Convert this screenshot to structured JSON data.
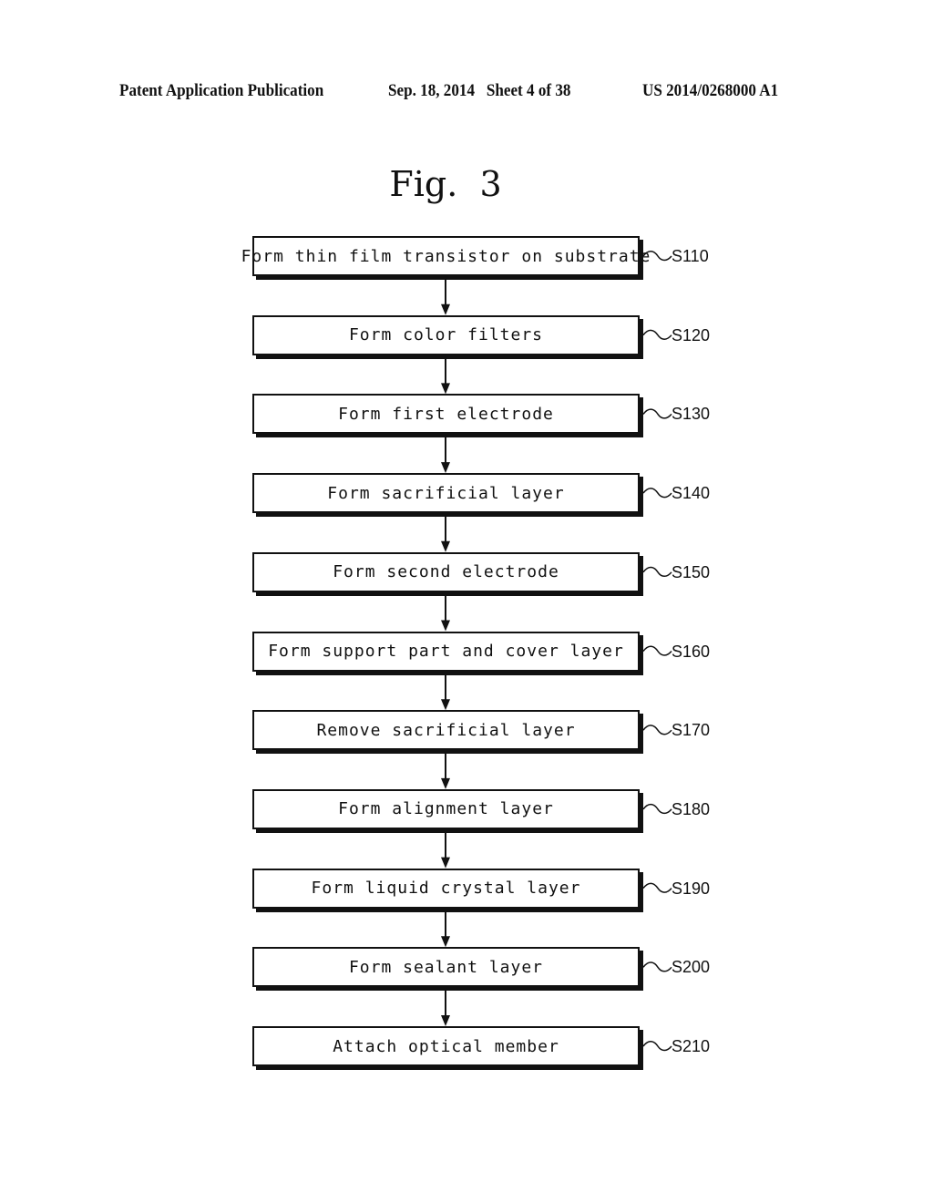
{
  "header": {
    "left": "Patent Application Publication",
    "middle": "Sep. 18, 2014   Sheet 4 of 38",
    "right": "US 2014/0268000 A1"
  },
  "figure": {
    "title": "Fig.  3"
  },
  "steps": [
    {
      "text": "Form thin film transistor on substrate",
      "ref": "S110"
    },
    {
      "text": "Form color filters",
      "ref": "S120"
    },
    {
      "text": "Form first electrode",
      "ref": "S130"
    },
    {
      "text": "Form sacrificial layer",
      "ref": "S140"
    },
    {
      "text": "Form second electrode",
      "ref": "S150"
    },
    {
      "text": "Form support part and cover layer",
      "ref": "S160"
    },
    {
      "text": "Remove sacrificial layer",
      "ref": "S170"
    },
    {
      "text": "Form alignment layer",
      "ref": "S180"
    },
    {
      "text": "Form liquid crystal layer",
      "ref": "S190"
    },
    {
      "text": "Form sealant layer",
      "ref": "S200"
    },
    {
      "text": "Attach optical member",
      "ref": "S210"
    }
  ]
}
